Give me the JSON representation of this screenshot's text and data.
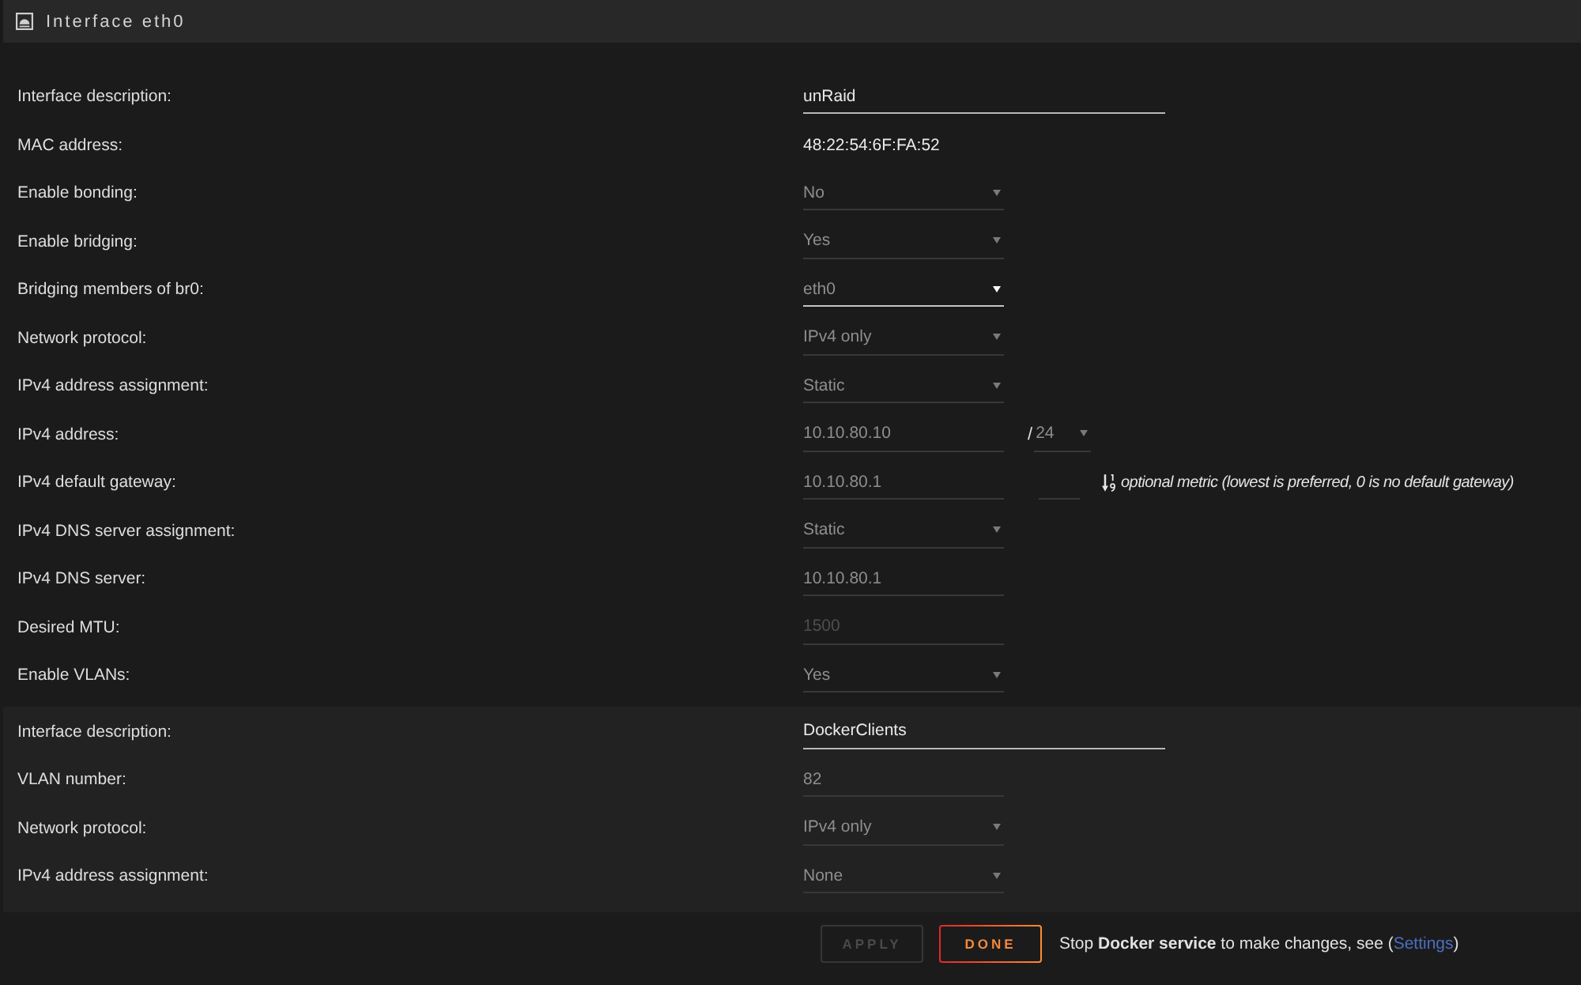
{
  "header": {
    "title": "Interface eth0"
  },
  "sections": [
    {
      "kind": "interface",
      "rows": [
        {
          "label": "Interface description:",
          "fields": [
            {
              "kind": "text",
              "value": "unRaid",
              "disabled": false
            }
          ]
        },
        {
          "label": "MAC address:",
          "fields": [
            {
              "kind": "static",
              "value": "48:22:54:6F:FA:52"
            }
          ]
        },
        {
          "label": "Enable bonding:",
          "fields": [
            {
              "kind": "select",
              "value": "No",
              "disabled": true
            }
          ]
        },
        {
          "label": "Enable bridging:",
          "fields": [
            {
              "kind": "select",
              "value": "Yes",
              "disabled": true
            }
          ]
        },
        {
          "label": "Bridging members of br0:",
          "fields": [
            {
              "kind": "select",
              "value": "eth0",
              "disabled": false
            }
          ]
        },
        {
          "label": "Network protocol:",
          "fields": [
            {
              "kind": "select",
              "value": "IPv4 only",
              "disabled": true
            }
          ]
        },
        {
          "label": "IPv4 address assignment:",
          "fields": [
            {
              "kind": "select",
              "value": "Static",
              "disabled": true
            }
          ]
        },
        {
          "label": "IPv4 address:",
          "fields": [
            {
              "kind": "input",
              "value": "10.10.80.10",
              "disabled": true
            },
            {
              "kind": "separator",
              "value": "/"
            },
            {
              "kind": "mask",
              "value": "24",
              "disabled": true
            }
          ]
        },
        {
          "label": "IPv4 default gateway:",
          "fields": [
            {
              "kind": "input",
              "value": "10.10.80.1",
              "disabled": true
            },
            {
              "kind": "metric",
              "disabled": true
            },
            {
              "kind": "note",
              "value": "optional metric (lowest is preferred, 0 is no default gateway)"
            }
          ]
        },
        {
          "label": "IPv4 DNS server assignment:",
          "fields": [
            {
              "kind": "select",
              "value": "Static",
              "disabled": true
            }
          ]
        },
        {
          "label": "IPv4 DNS server:",
          "fields": [
            {
              "kind": "input",
              "value": "10.10.80.1",
              "disabled": true
            }
          ]
        },
        {
          "label": "Desired MTU:",
          "fields": [
            {
              "kind": "input",
              "placeholder": "1500",
              "disabled": true
            }
          ]
        },
        {
          "label": "Enable VLANs:",
          "fields": [
            {
              "kind": "select",
              "value": "Yes",
              "disabled": true
            }
          ]
        }
      ]
    },
    {
      "kind": "vlan",
      "rows": [
        {
          "label": "Interface description:",
          "fields": [
            {
              "kind": "text",
              "value": "DockerClients",
              "disabled": false
            }
          ]
        },
        {
          "label": "VLAN number:",
          "fields": [
            {
              "kind": "input",
              "value": "82",
              "disabled": true
            }
          ]
        },
        {
          "label": "Network protocol:",
          "fields": [
            {
              "kind": "select",
              "value": "IPv4 only",
              "disabled": true
            }
          ]
        },
        {
          "label": "IPv4 address assignment:",
          "fields": [
            {
              "kind": "select",
              "value": "None",
              "disabled": true
            }
          ]
        }
      ]
    }
  ],
  "footer": {
    "buttons": [
      {
        "label": "APPLY",
        "disabled": true
      },
      {
        "label": "DONE",
        "disabled": false
      }
    ],
    "notice": {
      "before": "Stop **Docker service** to make changes, see (",
      "link": "Settings",
      "after": ")"
    }
  }
}
